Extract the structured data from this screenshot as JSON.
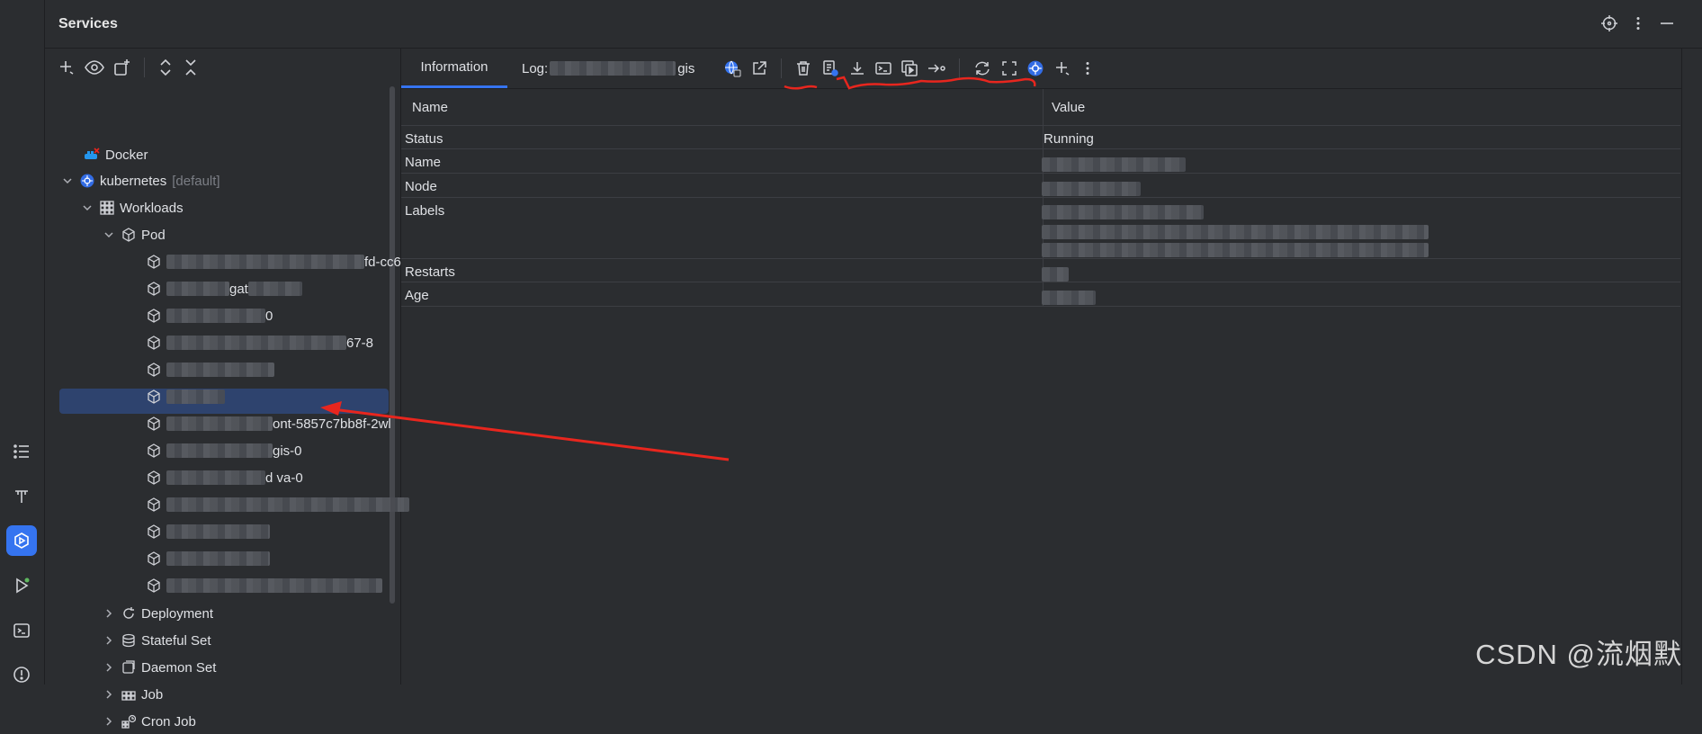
{
  "header": {
    "title": "Services"
  },
  "tree": {
    "docker": "Docker",
    "kubernetes": "kubernetes",
    "kubernetes_ctx": "[default]",
    "workloads": "Workloads",
    "pod": "Pod",
    "pods": [
      {
        "suffix": "fd-cc6"
      },
      {
        "suffix": "gat"
      },
      {
        "suffix": "0"
      },
      {
        "suffix": "67-8"
      },
      {
        "suffix": ""
      },
      {
        "suffix": ""
      },
      {
        "suffix": "ont-5857c7bb8f-2wl"
      },
      {
        "suffix": "gis-0",
        "selected": true
      },
      {
        "suffix": "d   va-0"
      },
      {
        "suffix": "m"
      },
      {
        "suffix": ""
      },
      {
        "suffix": ""
      },
      {
        "suffix": ""
      }
    ],
    "deployment": "Deployment",
    "stateful_set": "Stateful Set",
    "daemon_set": "Daemon Set",
    "job": "Job",
    "cron_job": "Cron Job"
  },
  "tabs": {
    "information": "Information",
    "log": "Log:",
    "log_suffix": "gis"
  },
  "table": {
    "col_name": "Name",
    "col_value": "Value",
    "rows": [
      {
        "name": "Status",
        "value": "Running"
      },
      {
        "name": "Name",
        "value": ""
      },
      {
        "name": "Node",
        "value": ""
      },
      {
        "name": "Labels",
        "value": ""
      },
      {
        "name": "Restarts",
        "value": ""
      },
      {
        "name": "Age",
        "value": ""
      }
    ]
  },
  "watermark": "CSDN @流烟默",
  "colors": {
    "accent": "#3574f0",
    "selection": "#2e436e",
    "annotation": "#e8261e",
    "background": "#2b2d30"
  }
}
